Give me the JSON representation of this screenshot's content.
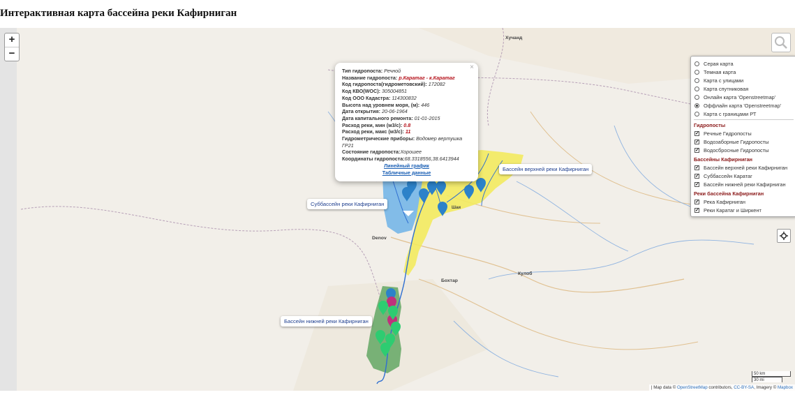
{
  "page": {
    "title": "Интерактивная карта бассейна реки Кафирниган"
  },
  "map": {
    "zoom_in": "+",
    "zoom_out": "−",
    "place_labels": [
      "Хучанд",
      "Denov",
      "Бохтар",
      "Кулоб",
      "Шаи"
    ],
    "basin_labels": {
      "upper": "Бассейн верхней реки Кафирниган",
      "sub": "Суббассейн реки Кафирниган",
      "lower": "Бассейн нижней реки Кафирниган"
    },
    "scale": {
      "km": "50 km",
      "mi": "30 mi"
    },
    "attribution": {
      "prefix": "| Map data © ",
      "osm": "OpenStreetMap",
      "contributors": " contributors, ",
      "license": "CC-BY-SA",
      "imagery": ", Imagery © ",
      "mapbox": "Mapbox"
    },
    "colors": {
      "upper_basin": "#f3ea5f",
      "sub_basin": "#6fb3e8",
      "lower_basin": "#6aab6a",
      "rivers": "#2f6fd1",
      "marker_blue": "#2c82c9",
      "marker_green": "#2ecc71",
      "marker_magenta": "#c0317c"
    }
  },
  "layers": {
    "base": [
      {
        "label": "Серая карта",
        "selected": false
      },
      {
        "label": "Темная карта",
        "selected": false
      },
      {
        "label": "Карта с улицами",
        "selected": false
      },
      {
        "label": "Карта спутниковая",
        "selected": false
      },
      {
        "label": "Онлайн карта 'Openstreetmap'",
        "selected": false
      },
      {
        "label": "Оффлайн карта 'Openstreetmap'",
        "selected": true
      },
      {
        "label": "Карта с границами РТ",
        "selected": false
      }
    ],
    "groups": [
      {
        "title": "Гидропосты",
        "items": [
          "Речные Гидропосты",
          "Водозаборные Гидропосты",
          "Водосбросные Гидропосты"
        ]
      },
      {
        "title": "Бассейны Кафирниган",
        "items": [
          "Бассейн верхней реки Кафирниган",
          "Суббассейн Каратаг",
          "Бассейн нижней реки Кафирниган"
        ]
      },
      {
        "title": "Реки бассейна Кафирниган",
        "items": [
          "Река Кафирниган",
          "Реки Каратаг и Ширкент"
        ]
      }
    ]
  },
  "popup": {
    "close": "×",
    "fields": [
      {
        "label": "Тип гидропоста: ",
        "value": "Речной",
        "style": "i"
      },
      {
        "label": "Название гидропоста: ",
        "value": "р.Каратаг - к.Каратаг",
        "style": "red"
      },
      {
        "label": "Код гидропоста(гидрометовский): ",
        "value": "172082",
        "style": "i"
      },
      {
        "label": "Код КВО(WOC): ",
        "value": "305004851",
        "style": "i"
      },
      {
        "label": "Код ООО Кадастра: ",
        "value": "114300832",
        "style": "i"
      },
      {
        "label": "Высота над уровнем моря, (м): ",
        "value": "446",
        "style": "i"
      },
      {
        "label": "Дата открытия: ",
        "value": "20-06-1964",
        "style": "i"
      },
      {
        "label": "Дата капитального ремонта: ",
        "value": "01-01-2015",
        "style": "i"
      },
      {
        "label": "Расход реки, мин (м3/с): ",
        "value": "0.8",
        "style": "red"
      },
      {
        "label": "Расход реки, макс (м3/с): ",
        "value": "11",
        "style": "red"
      },
      {
        "label": "Гидрометрические приборы: ",
        "value": "Водомер вертушка ГР21",
        "style": "i"
      },
      {
        "label": "Состояние гидропоста:",
        "value": "Хорошее",
        "style": "i"
      },
      {
        "label": "Координаты гидропоста:",
        "value": "68.3318556,38.6413944",
        "style": "i"
      }
    ],
    "link_line": "Линейный график",
    "link_table": "Табличные данные"
  }
}
